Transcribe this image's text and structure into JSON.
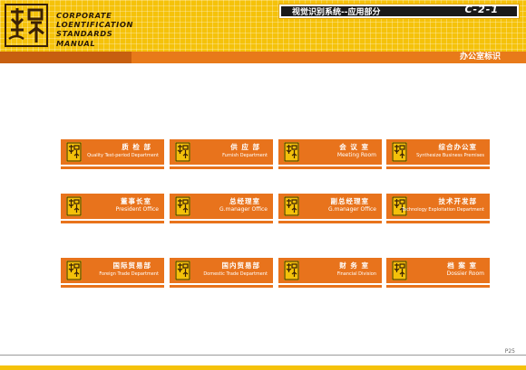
{
  "header": {
    "logo_icon": "seal-logo-icon",
    "company_lines": [
      "CORPORATE",
      "LOENTIFICATION",
      "STANDARDS",
      "MANUAL"
    ],
    "system_title": "视觉识别系统--应用部分",
    "page_code": "C-2-1",
    "section_title": "办公室标识"
  },
  "signs": [
    {
      "cn": "质 检 部",
      "en": "Quality Test-period Department"
    },
    {
      "cn": "供 应 部",
      "en": "Furnish Department"
    },
    {
      "cn": "会 议 室",
      "en": "Meeting Room",
      "big": true
    },
    {
      "cn": "综合办公室",
      "en": "Synthesize Business Premises"
    },
    {
      "cn": "董事长室",
      "en": "President Office",
      "big": true
    },
    {
      "cn": "总经理室",
      "en": "G.manager Office",
      "big": true
    },
    {
      "cn": "副总经理室",
      "en": "G.manager Office",
      "big": true
    },
    {
      "cn": "技术开发部",
      "en": "Technology Exploitation Department"
    },
    {
      "cn": "国际贸易部",
      "en": "Foreign Trade Department"
    },
    {
      "cn": "国内贸易部",
      "en": "Domestic Trade Department"
    },
    {
      "cn": "财 务 室",
      "en": "Financial Division"
    },
    {
      "cn": "档 案 室",
      "en": "Dossier Room",
      "big": true
    }
  ],
  "footer": {
    "page_number": "P25"
  },
  "colors": {
    "header_yellow": "#f5c20a",
    "sign_orange": "#e8731c",
    "strip_orange": "#e87a1a"
  }
}
